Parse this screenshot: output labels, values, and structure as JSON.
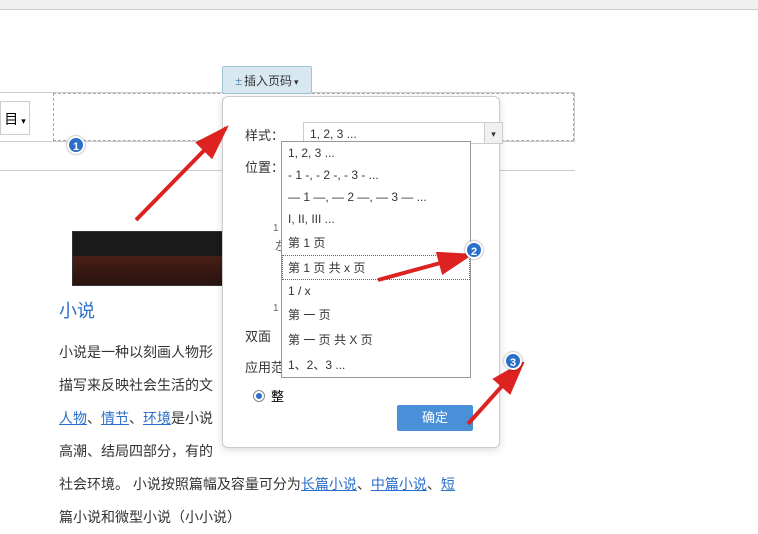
{
  "insert_button": {
    "label": "插入页码",
    "icon": "±"
  },
  "dialog": {
    "style_label": "样式：",
    "style_value": "1, 2, 3 ...",
    "position_label": "位置：",
    "pos_left": "左",
    "duplex_label": "双面",
    "scope_label": "应用范",
    "scope_option": "整"
  },
  "dropdown": {
    "items": [
      "1, 2, 3 ...",
      "- 1 -, - 2 -, - 3 - ...",
      "— 1 —, — 2 —, — 3 — ...",
      "I, II, III ...",
      "第 1 页",
      "第 1 页 共 x 页",
      "1 / x",
      "第 一 页",
      "第 一 页 共 X 页",
      "1、2、3 ..."
    ],
    "highlighted_index": 5
  },
  "ok_button": "确定",
  "article": {
    "title": "小说",
    "p1a": "小说是一种以刻画人物形",
    "p1b": "描写来反映社会生活的文",
    "links": {
      "characters": "人物",
      "plot": "情节",
      "environment": "环境"
    },
    "sep": "、",
    "p2": "是小说",
    "p3": "高潮、结局四部分，有的",
    "p4a": "社会环境。 小说按照篇幅及容量可分为",
    "link_long": "长篇小说",
    "link_mid": "中篇小说",
    "link_short": "短",
    "p5": "篇小说和微型小说（小小说）"
  },
  "format_box": "目",
  "page_markers": {
    "m1": "1",
    "m2": "1"
  },
  "callouts": {
    "c1": "1",
    "c2": "2",
    "c3": "3"
  }
}
